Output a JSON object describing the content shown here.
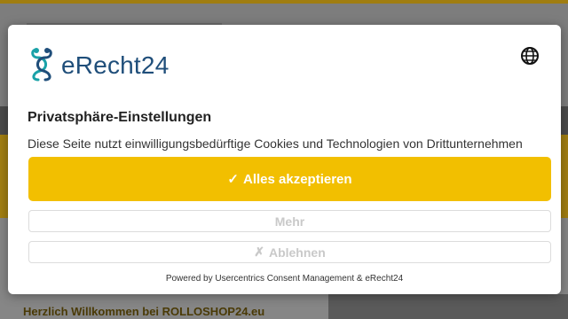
{
  "background": {
    "welcome_text": "Herzlich Willkommen bei ROLLOSHOP24.eu"
  },
  "dialog": {
    "brand_name": "eRecht24",
    "title": "Privatsphäre-Einstellungen",
    "description": "Diese Seite nutzt einwilligungsbedürftige Cookies und Technologien von Drittunternehmen",
    "accept": {
      "icon": "checkmark-icon",
      "glyph": "✓",
      "label": "Alles akzeptieren"
    },
    "more": {
      "label": "Mehr"
    },
    "deny": {
      "icon": "cross-icon",
      "glyph": "✗",
      "label": "Ablehnen"
    },
    "powered_by": "Powered by Usercentrics Consent Management & eRecht24",
    "language_icon": "globe-icon"
  },
  "colors": {
    "accent": "#f2bf00",
    "brand": "#1f4e7a",
    "brand_teal": "#1aa2a8"
  }
}
